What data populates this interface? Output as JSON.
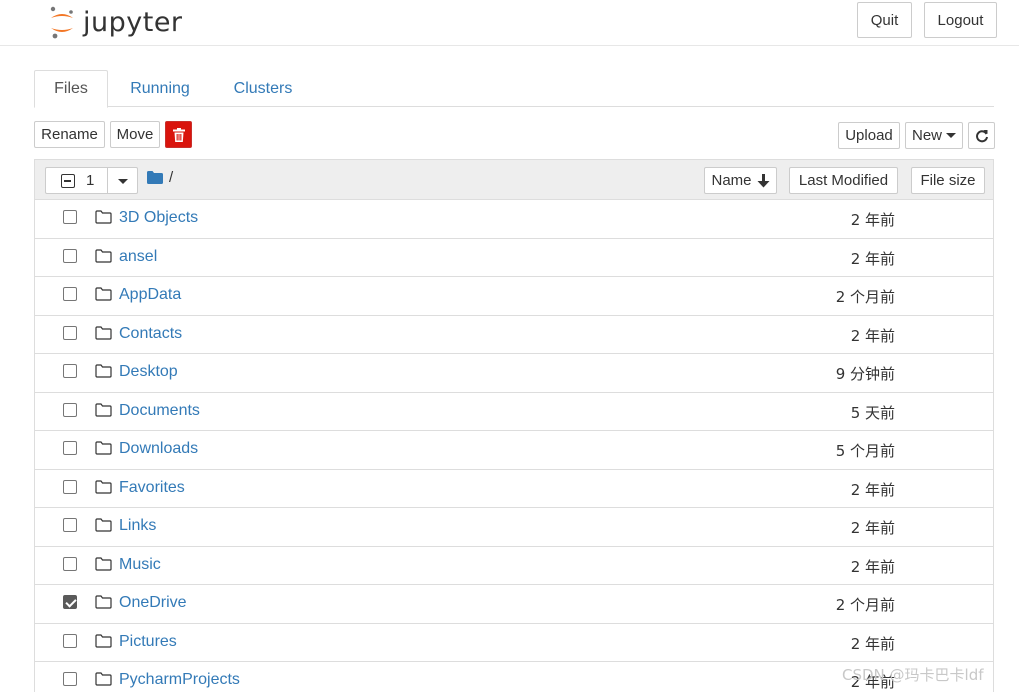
{
  "header": {
    "logo_text": "jupyter",
    "quit_label": "Quit",
    "logout_label": "Logout"
  },
  "tabs": [
    {
      "label": "Files",
      "active": true
    },
    {
      "label": "Running",
      "active": false
    },
    {
      "label": "Clusters",
      "active": false
    }
  ],
  "toolbar": {
    "rename_label": "Rename",
    "move_label": "Move",
    "delete_icon": "trash-icon",
    "upload_label": "Upload",
    "new_label": "New",
    "refresh_icon": "refresh-icon"
  },
  "list_header": {
    "selected_count": "1",
    "breadcrumb_path": "/",
    "sort_name_label": "Name",
    "sort_modified_label": "Last Modified",
    "sort_size_label": "File size"
  },
  "files": [
    {
      "name": "3D Objects",
      "modified": "2 年前",
      "checked": false
    },
    {
      "name": "ansel",
      "modified": "2 年前",
      "checked": false
    },
    {
      "name": "AppData",
      "modified": "2 个月前",
      "checked": false
    },
    {
      "name": "Contacts",
      "modified": "2 年前",
      "checked": false
    },
    {
      "name": "Desktop",
      "modified": "9 分钟前",
      "checked": false
    },
    {
      "name": "Documents",
      "modified": "5 天前",
      "checked": false
    },
    {
      "name": "Downloads",
      "modified": "5 个月前",
      "checked": false
    },
    {
      "name": "Favorites",
      "modified": "2 年前",
      "checked": false
    },
    {
      "name": "Links",
      "modified": "2 年前",
      "checked": false
    },
    {
      "name": "Music",
      "modified": "2 年前",
      "checked": false
    },
    {
      "name": "OneDrive",
      "modified": "2 个月前",
      "checked": true
    },
    {
      "name": "Pictures",
      "modified": "2 年前",
      "checked": false
    },
    {
      "name": "PycharmProjects",
      "modified": "2 年前",
      "checked": false
    }
  ],
  "watermark": "CSDN @玛卡巴卡ldf",
  "colors": {
    "link": "#337ab7",
    "delete": "#d9140d",
    "logo_orange": "#f37726"
  }
}
